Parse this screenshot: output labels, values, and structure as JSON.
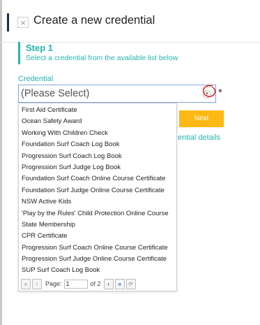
{
  "header": {
    "title": "Create a new credential",
    "close_glyph": "×"
  },
  "step": {
    "title": "Step 1",
    "subtitle": "Select a credential from the available list below"
  },
  "credential": {
    "label": "Credential",
    "selected": "(Please Select)",
    "required_marker": "*",
    "options": [
      "First Aid Certificate",
      "Ocean Safety Award",
      "Working With Children Check",
      "Foundation Surf Coach Log Book",
      "Progression Surf Coach Log Book",
      "Progression Surf Judge Log Book",
      "Foundation Surf Coach Online Course Certificate",
      "Foundation Surf Judge Online Course Certificate",
      "NSW Active Kids",
      "'Play by the Rules' Child Protection Online Course",
      "State Membership",
      "CPR Certificate",
      "Progression Surf Coach Online Course Certificate",
      "Progression Surf Judge Online Course Certificate",
      "SUP Surf Coach Log Book"
    ]
  },
  "pager": {
    "page_label": "Page:",
    "page_value": "1",
    "of_text": "of 2"
  },
  "actions": {
    "next_label": "Next",
    "details_link": "ential details"
  },
  "colors": {
    "teal": "#27b3ae",
    "next": "#fdb813",
    "annotation": "#e0201b"
  }
}
